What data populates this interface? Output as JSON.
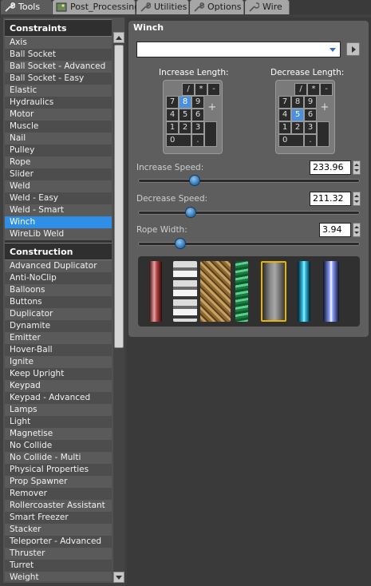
{
  "tabs": [
    {
      "label": "Tools",
      "icon": "wrench-icon",
      "active": true
    },
    {
      "label": "Post_Processing",
      "icon": "image-icon",
      "active": false
    },
    {
      "label": "Utilities",
      "icon": "wrench-icon",
      "active": false
    },
    {
      "label": "Options",
      "icon": "wrench-icon",
      "active": false
    },
    {
      "label": "Wire",
      "icon": "wire-icon",
      "active": false
    }
  ],
  "constraints": {
    "header": "Constraints",
    "items": [
      "Axis",
      "Ball Socket",
      "Ball Socket - Advanced",
      "Ball Socket - Easy",
      "Elastic",
      "Hydraulics",
      "Motor",
      "Muscle",
      "Nail",
      "Pulley",
      "Rope",
      "Slider",
      "Weld",
      "Weld - Easy",
      "Weld - Smart",
      "Winch",
      "WireLib Weld"
    ],
    "selected": "Winch"
  },
  "construction": {
    "header": "Construction",
    "items": [
      "Advanced Duplicator",
      "Anti-NoClip",
      "Balloons",
      "Buttons",
      "Duplicator",
      "Dynamite",
      "Emitter",
      "Hover-Ball",
      "Ignite",
      "Keep Upright",
      "Keypad",
      "Keypad - Advanced",
      "Lamps",
      "Light",
      "Magnetise",
      "No Collide",
      "No Collide - Multi",
      "Physical Properties",
      "Prop Spawner",
      "Remover",
      "Rollercoaster Assistant",
      "Smart Freezer",
      "Stacker",
      "Teleporter - Advanced",
      "Thruster",
      "Turret",
      "Weight"
    ]
  },
  "panel": {
    "title": "Winch",
    "dropdown_value": "",
    "increase_length": {
      "label": "Increase Length:",
      "keys": [
        "/",
        "*",
        "-",
        "7",
        "8",
        "9",
        "+",
        "4",
        "5",
        "6",
        "1",
        "2",
        "3",
        "0",
        "."
      ],
      "selected_key": "8"
    },
    "decrease_length": {
      "label": "Decrease Length:",
      "keys": [
        "/",
        "*",
        "-",
        "7",
        "8",
        "9",
        "+",
        "4",
        "5",
        "6",
        "1",
        "2",
        "3",
        "0",
        "."
      ],
      "selected_key": "5"
    },
    "increase_speed": {
      "label": "Increase Speed:",
      "value": "233.96",
      "fraction": 0.24
    },
    "decrease_speed": {
      "label": "Decrease Speed:",
      "value": "211.32",
      "fraction": 0.22
    },
    "rope_width": {
      "label": "Rope Width:",
      "value": "3.94",
      "fraction": 0.17
    },
    "materials": [
      "red-cable-material",
      "metal-chain-material",
      "rope-material",
      "green-twisted-material",
      "grey-metal-material",
      "electric-blue-material",
      "electric-white-material"
    ],
    "selected_material": "grey-metal-material"
  },
  "colors": {
    "selection": "#2f8fe6",
    "slider_knob": "#2a6fb0",
    "material_highlight": "#e8b400"
  }
}
